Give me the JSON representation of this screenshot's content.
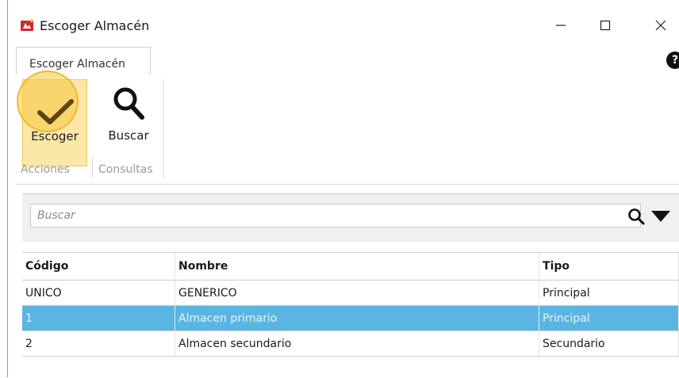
{
  "window": {
    "title": "Escoger Almacén",
    "controls": {
      "minimize": "—",
      "maximize": "☐",
      "close": "✕"
    }
  },
  "ribbon": {
    "tab_label": "Escoger Almacén",
    "help_icon": "?",
    "buttons": {
      "choose_label": "Escoger",
      "search_label": "Buscar"
    },
    "groups": {
      "actions": "Acciones",
      "queries": "Consultas"
    }
  },
  "search": {
    "placeholder": "Buscar",
    "value": ""
  },
  "table": {
    "headers": [
      "Código",
      "Nombre",
      "Tipo"
    ],
    "rows": [
      [
        "UNICO",
        "GENERICO",
        "Principal"
      ],
      [
        "1",
        "Almacen primario",
        "Principal"
      ],
      [
        "2",
        "Almacen secundario",
        "Secundario"
      ]
    ],
    "selected_row": 1
  },
  "colors": {
    "selection": "#5ab5e3",
    "button_highlight": "#fbe7a8",
    "app_icon": "#d6262b"
  }
}
